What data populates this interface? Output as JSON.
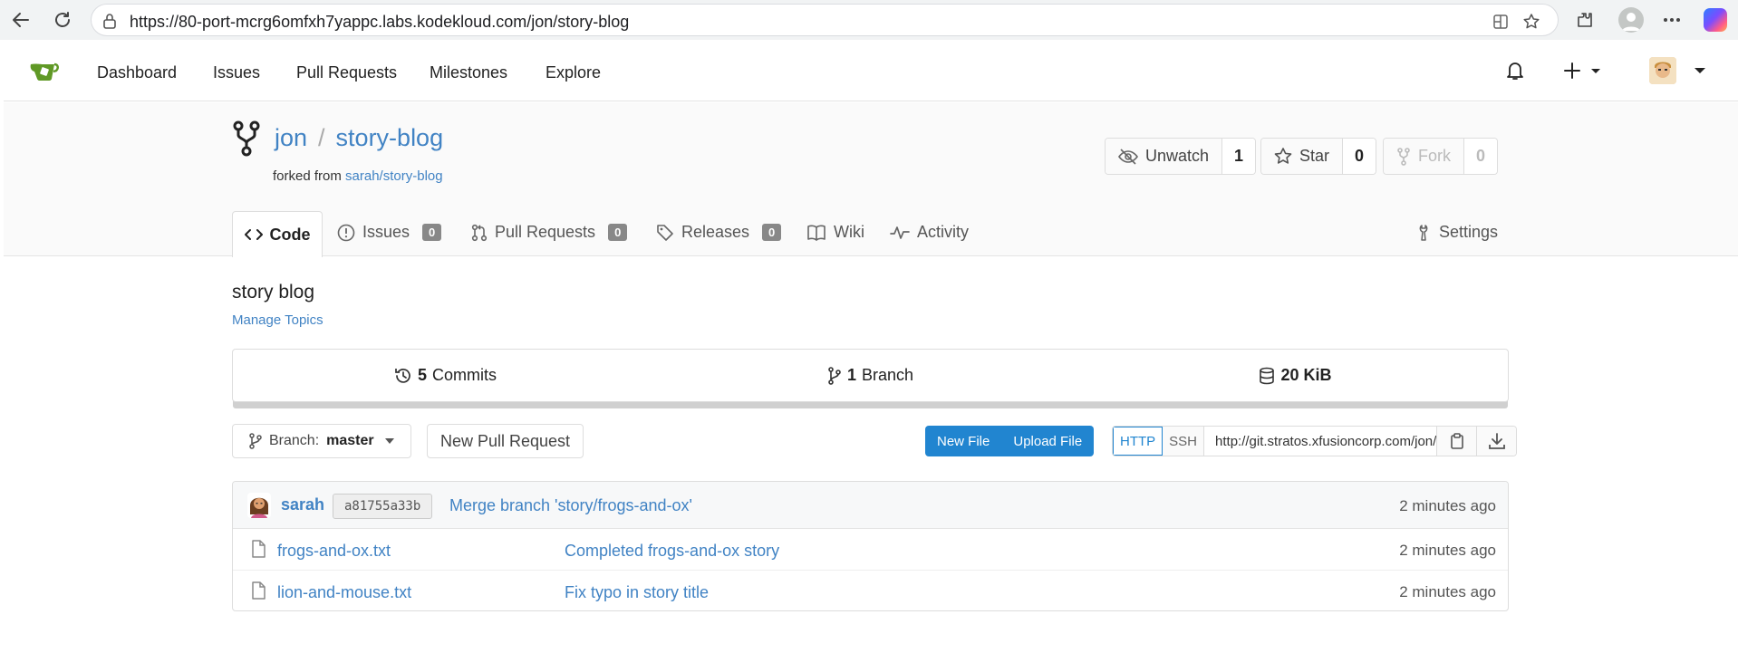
{
  "browser": {
    "url": "https://80-port-mcrg6omfxh7yappc.labs.kodekloud.com/jon/story-blog"
  },
  "nav": {
    "items": [
      "Dashboard",
      "Issues",
      "Pull Requests",
      "Milestones",
      "Explore"
    ]
  },
  "repo": {
    "owner": "jon",
    "separator": "/",
    "name": "story-blog",
    "forked_from_prefix": "forked from",
    "forked_from_link": "sarah/story-blog",
    "watch_label": "Unwatch",
    "watch_count": "1",
    "star_label": "Star",
    "star_count": "0",
    "fork_label": "Fork",
    "fork_count": "0"
  },
  "tabs": {
    "code": "Code",
    "issues": "Issues",
    "issues_count": "0",
    "pulls": "Pull Requests",
    "pulls_count": "0",
    "releases": "Releases",
    "releases_count": "0",
    "wiki": "Wiki",
    "activity": "Activity",
    "settings": "Settings"
  },
  "main": {
    "description": "story blog",
    "manage_topics": "Manage Topics"
  },
  "stats": {
    "commits_count": "5",
    "commits_label": "Commits",
    "branches_count": "1",
    "branches_label": "Branch",
    "size": "20 KiB"
  },
  "toolbar": {
    "branch_prefix": "Branch:",
    "branch_name": "master",
    "new_pr": "New Pull Request",
    "new_file": "New File",
    "upload_file": "Upload File",
    "http": "HTTP",
    "ssh": "SSH",
    "clone_url": "http://git.stratos.xfusioncorp.com/jon/story-blog.git"
  },
  "latest_commit": {
    "author": "sarah",
    "sha": "a81755a33b",
    "message": "Merge branch 'story/frogs-and-ox'",
    "time": "2 minutes ago"
  },
  "files": [
    {
      "name": "frogs-and-ox.txt",
      "message": "Completed frogs-and-ox story",
      "time": "2 minutes ago"
    },
    {
      "name": "lion-and-mouse.txt",
      "message": "Fix typo in story title",
      "time": "2 minutes ago"
    }
  ]
}
